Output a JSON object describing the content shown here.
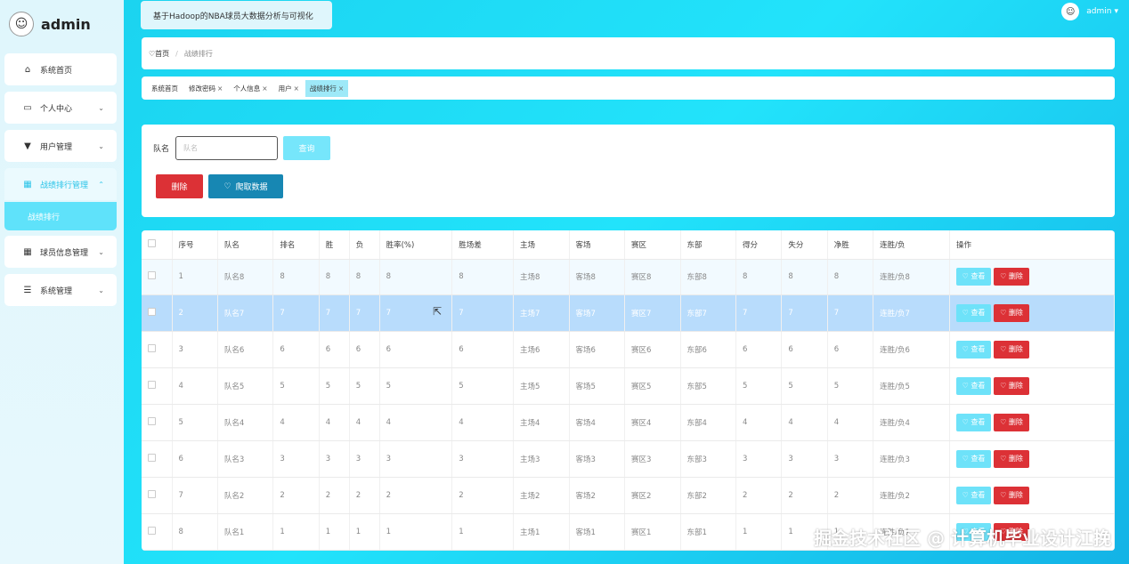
{
  "app": {
    "brand": "admin",
    "system_title": "基于Hadoop的NBA球员大数据分析与可视化",
    "user": "admin"
  },
  "sidebar": {
    "items": [
      {
        "label": "系统首页",
        "icon": "home-icon"
      },
      {
        "label": "个人中心",
        "icon": "card-icon"
      },
      {
        "label": "用户管理",
        "icon": "user-icon"
      },
      {
        "label": "战绩排行管理",
        "icon": "grid-icon"
      },
      {
        "label": "球员信息管理",
        "icon": "grid-icon"
      },
      {
        "label": "系统管理",
        "icon": "list-icon"
      }
    ],
    "submenu": {
      "label": "战绩排行"
    }
  },
  "breadcrumb": {
    "home": "首页",
    "current": "战绩排行"
  },
  "tabs": [
    {
      "label": "系统首页",
      "closable": false
    },
    {
      "label": "修改密码",
      "closable": true
    },
    {
      "label": "个人信息",
      "closable": true
    },
    {
      "label": "用户",
      "closable": true
    },
    {
      "label": "战绩排行",
      "closable": true,
      "active": true
    }
  ],
  "search": {
    "label": "队名",
    "placeholder": "队名",
    "query_button": "查询",
    "delete_button": "删除",
    "crawl_button": "爬取数据"
  },
  "table": {
    "headers": [
      "序号",
      "队名",
      "排名",
      "胜",
      "负",
      "胜率(%)",
      "胜场差",
      "主场",
      "客场",
      "赛区",
      "东部",
      "得分",
      "失分",
      "净胜",
      "连胜/负",
      "操作"
    ],
    "view_label": "查看",
    "delete_label": "删除",
    "rows": [
      [
        "1",
        "队名8",
        "8",
        "8",
        "8",
        "8",
        "8",
        "主场8",
        "客场8",
        "赛区8",
        "东部8",
        "8",
        "8",
        "8",
        "连胜/负8"
      ],
      [
        "2",
        "队名7",
        "7",
        "7",
        "7",
        "7",
        "7",
        "主场7",
        "客场7",
        "赛区7",
        "东部7",
        "7",
        "7",
        "7",
        "连胜/负7"
      ],
      [
        "3",
        "队名6",
        "6",
        "6",
        "6",
        "6",
        "6",
        "主场6",
        "客场6",
        "赛区6",
        "东部6",
        "6",
        "6",
        "6",
        "连胜/负6"
      ],
      [
        "4",
        "队名5",
        "5",
        "5",
        "5",
        "5",
        "5",
        "主场5",
        "客场5",
        "赛区5",
        "东部5",
        "5",
        "5",
        "5",
        "连胜/负5"
      ],
      [
        "5",
        "队名4",
        "4",
        "4",
        "4",
        "4",
        "4",
        "主场4",
        "客场4",
        "赛区4",
        "东部4",
        "4",
        "4",
        "4",
        "连胜/负4"
      ],
      [
        "6",
        "队名3",
        "3",
        "3",
        "3",
        "3",
        "3",
        "主场3",
        "客场3",
        "赛区3",
        "东部3",
        "3",
        "3",
        "3",
        "连胜/负3"
      ],
      [
        "7",
        "队名2",
        "2",
        "2",
        "2",
        "2",
        "2",
        "主场2",
        "客场2",
        "赛区2",
        "东部2",
        "2",
        "2",
        "2",
        "连胜/负2"
      ],
      [
        "8",
        "队名1",
        "1",
        "1",
        "1",
        "1",
        "1",
        "主场1",
        "客场1",
        "赛区1",
        "东部1",
        "1",
        "1",
        "1",
        "连胜/负1"
      ]
    ]
  },
  "watermark": "掘金技术社区 @ 计算机毕业设计江挽"
}
